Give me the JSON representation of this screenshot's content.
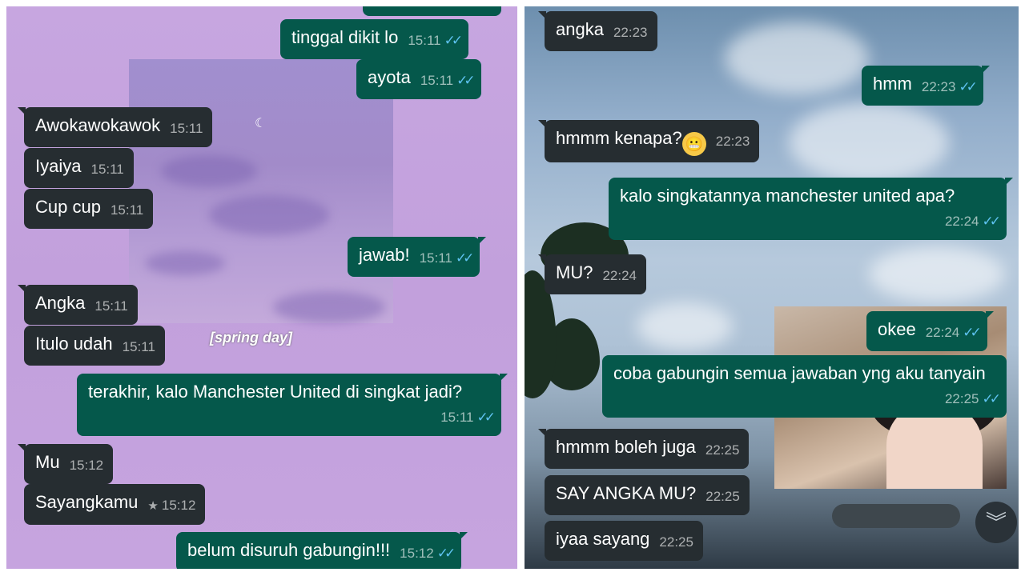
{
  "left": {
    "caption": "[spring day]",
    "messages": [
      {
        "text": "tinggal dikit lo",
        "time": "15:11",
        "dir": "out"
      },
      {
        "text": "ayota",
        "time": "15:11",
        "dir": "out"
      },
      {
        "text": "Awokawokawok",
        "time": "15:11",
        "dir": "in"
      },
      {
        "text": "Iyaiya",
        "time": "15:11",
        "dir": "in"
      },
      {
        "text": "Cup cup",
        "time": "15:11",
        "dir": "in"
      },
      {
        "text": "jawab!",
        "time": "15:11",
        "dir": "out"
      },
      {
        "text": "Angka",
        "time": "15:11",
        "dir": "in"
      },
      {
        "text": "Itulo udah",
        "time": "15:11",
        "dir": "in"
      },
      {
        "text": "terakhir, kalo Manchester United di singkat jadi?",
        "time": "15:11",
        "dir": "out"
      },
      {
        "text": "Mu",
        "time": "15:12",
        "dir": "in"
      },
      {
        "text": "Sayangkamu",
        "time": "15:12",
        "dir": "in",
        "starred": true
      },
      {
        "text": "belum disuruh gabungin!!!",
        "time": "15:12",
        "dir": "out"
      }
    ]
  },
  "right": {
    "messages": [
      {
        "text": "angka",
        "time": "22:23",
        "dir": "in"
      },
      {
        "text": "hmm",
        "time": "22:23",
        "dir": "out"
      },
      {
        "text": "hmmm kenapa?",
        "time": "22:23",
        "dir": "in",
        "emoji": "grimacing-face-emoji"
      },
      {
        "text": "kalo singkatannya manchester united apa?",
        "time": "22:24",
        "dir": "out"
      },
      {
        "text": "MU?",
        "time": "22:24",
        "dir": "in"
      },
      {
        "text": "okee",
        "time": "22:24",
        "dir": "out"
      },
      {
        "text": "coba gabungin semua jawaban yng aku tanyain",
        "time": "22:25",
        "dir": "out"
      },
      {
        "text": "hmmm boleh juga",
        "time": "22:25",
        "dir": "in"
      },
      {
        "text": "SAY ANGKA MU?",
        "time": "22:25",
        "dir": "in"
      },
      {
        "text": "iyaa sayang",
        "time": "22:25",
        "dir": "in"
      }
    ],
    "scroll_icon": "double-chevron-down-icon"
  },
  "colors": {
    "incoming_bubble": "#262d31",
    "outgoing_bubble": "#05584b",
    "read_ticks": "#5ec2f0"
  }
}
